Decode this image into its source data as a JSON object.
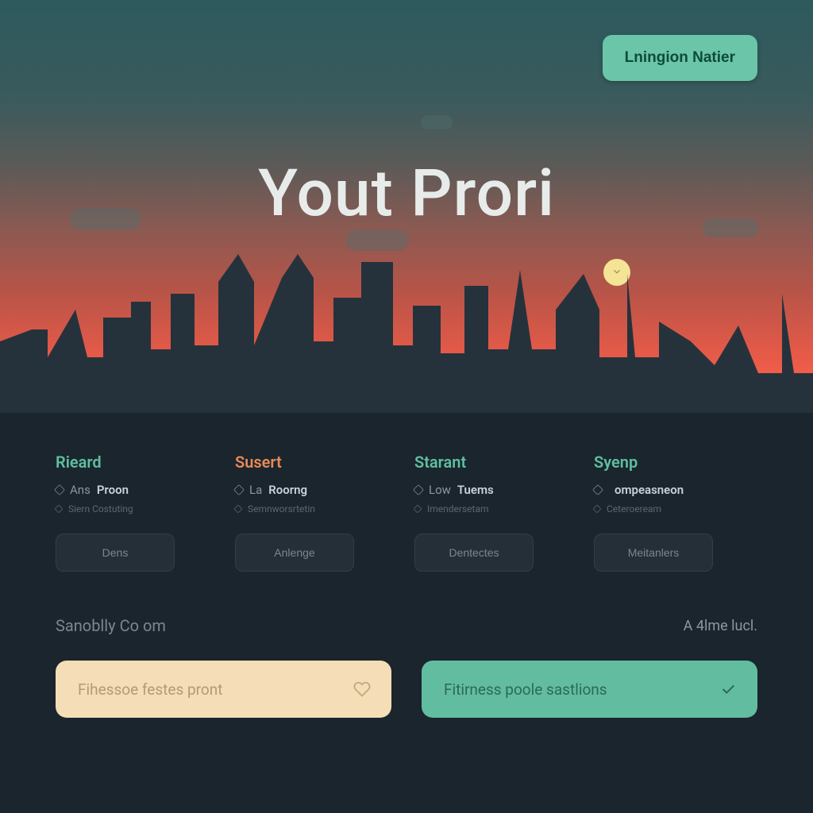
{
  "header": {
    "cta_label": "Lningion Natier"
  },
  "hero": {
    "title": "Yout Prori"
  },
  "cards": [
    {
      "title": "Rieard",
      "line_prefix": "Ans",
      "line_bold": "Proon",
      "sub": "Siern Costuting",
      "button": "Dens"
    },
    {
      "title": "Susert",
      "line_prefix": "La",
      "line_bold": "Roorng",
      "sub": "Semnworsrtetin",
      "button": "Anlenge"
    },
    {
      "title": "Starant",
      "line_prefix": "Low",
      "line_bold": "Tuems",
      "sub": "Imendersetam",
      "button": "Dentectes"
    },
    {
      "title": "Syenp",
      "line_prefix": "",
      "line_bold": "ompeasneon",
      "sub": "Ceteroeream",
      "button": "Meitanlers"
    }
  ],
  "footer": {
    "left": "Sanoblly Co om",
    "right": "A 4lme lucl."
  },
  "search": {
    "left_placeholder": "Fihessoe festes pront",
    "right_placeholder": "Fitirness poole sastlions"
  },
  "icons": {
    "chevron_down": "chevron-down-icon",
    "heart": "heart-icon",
    "check": "check-icon"
  }
}
